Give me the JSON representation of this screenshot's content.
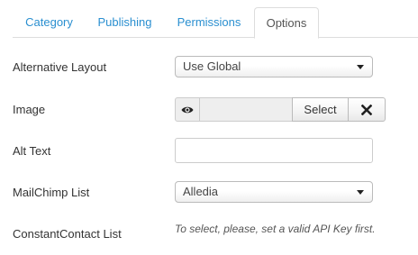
{
  "tabs": [
    {
      "label": "Category",
      "active": false
    },
    {
      "label": "Publishing",
      "active": false
    },
    {
      "label": "Permissions",
      "active": false
    },
    {
      "label": "Options",
      "active": true
    }
  ],
  "fields": {
    "alternative_layout": {
      "label": "Alternative Layout",
      "value": "Use Global"
    },
    "image": {
      "label": "Image",
      "value": "",
      "select_label": "Select",
      "preview_icon": "eye-icon",
      "clear_icon": "close-icon"
    },
    "alt_text": {
      "label": "Alt Text",
      "value": ""
    },
    "mailchimp_list": {
      "label": "MailChimp List",
      "value": "Alledia"
    },
    "constantcontact_list": {
      "label": "ConstantContact List",
      "note": "To select, please, set a valid API Key first."
    }
  },
  "colors": {
    "link": "#2a8fd0",
    "border": "#dddddd"
  }
}
